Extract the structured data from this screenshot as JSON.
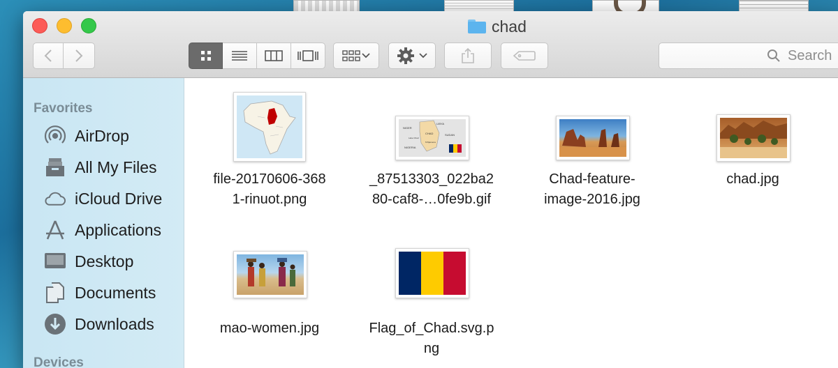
{
  "window": {
    "title": "chad"
  },
  "search": {
    "placeholder": "Search"
  },
  "sidebar": {
    "favorites_heading": "Favorites",
    "devices_heading": "Devices",
    "items": [
      {
        "label": "AirDrop",
        "icon": "airdrop-icon"
      },
      {
        "label": "All My Files",
        "icon": "all-files-icon"
      },
      {
        "label": "iCloud Drive",
        "icon": "cloud-icon"
      },
      {
        "label": "Applications",
        "icon": "applications-icon"
      },
      {
        "label": "Desktop",
        "icon": "desktop-icon"
      },
      {
        "label": "Documents",
        "icon": "documents-icon"
      },
      {
        "label": "Downloads",
        "icon": "downloads-icon"
      }
    ]
  },
  "files": [
    {
      "name": "file-20170606-368\n1-rinuot.png",
      "kind": "map-africa"
    },
    {
      "name": "_87513303_022ba2\n80-caf8-…0fe9b.gif",
      "kind": "map-chad"
    },
    {
      "name": "Chad-feature-\nimage-2016.jpg",
      "kind": "desert-rocks"
    },
    {
      "name": "chad.jpg",
      "kind": "oasis"
    },
    {
      "name": "mao-women.jpg",
      "kind": "women"
    },
    {
      "name": "Flag_of_Chad.svg.p\nng",
      "kind": "flag"
    }
  ],
  "map_labels": {
    "libya": "LIBYA",
    "niger": "NIGER",
    "chad": "CHAD",
    "sudan": "SUDAN",
    "nigeria": "NIGERIA",
    "lake": "Lake Chad",
    "ndjamena": "N'Djamena"
  },
  "colors": {
    "flag_blue": "#002664",
    "flag_yellow": "#fecb00",
    "flag_red": "#c60c30",
    "sidebar_bg": "#cfe8f3"
  }
}
